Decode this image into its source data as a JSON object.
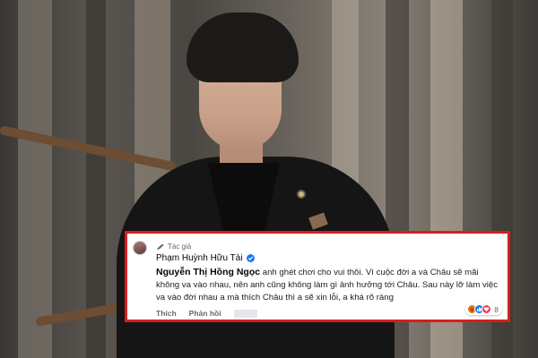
{
  "comment": {
    "author_badge": "Tác giả",
    "author_name": "Phạm Huỳnh Hữu Tài",
    "mention": "Nguyễn Thị Hồng Ngọc",
    "text": " anh ghét chơi cho vui thôi. Vì cuộc đời a và Châu sẽ mãi không va vào nhau, nên anh cũng không làm gì ảnh hưởng tới Châu. Sau này lỡ làm việc va vào đời nhau a mà thích Châu thì a sẽ xin lỗi, a khá rõ ràng",
    "like_label": "Thích",
    "reply_label": "Phản hồi",
    "reaction_count": "8",
    "reactions": [
      "angry-icon",
      "like-icon",
      "love-icon"
    ]
  },
  "colors": {
    "highlight_border": "#d81d1d",
    "verified": "#1877f2",
    "like": "#1877f2",
    "love": "#f33e58",
    "angry": "#e9710f"
  }
}
